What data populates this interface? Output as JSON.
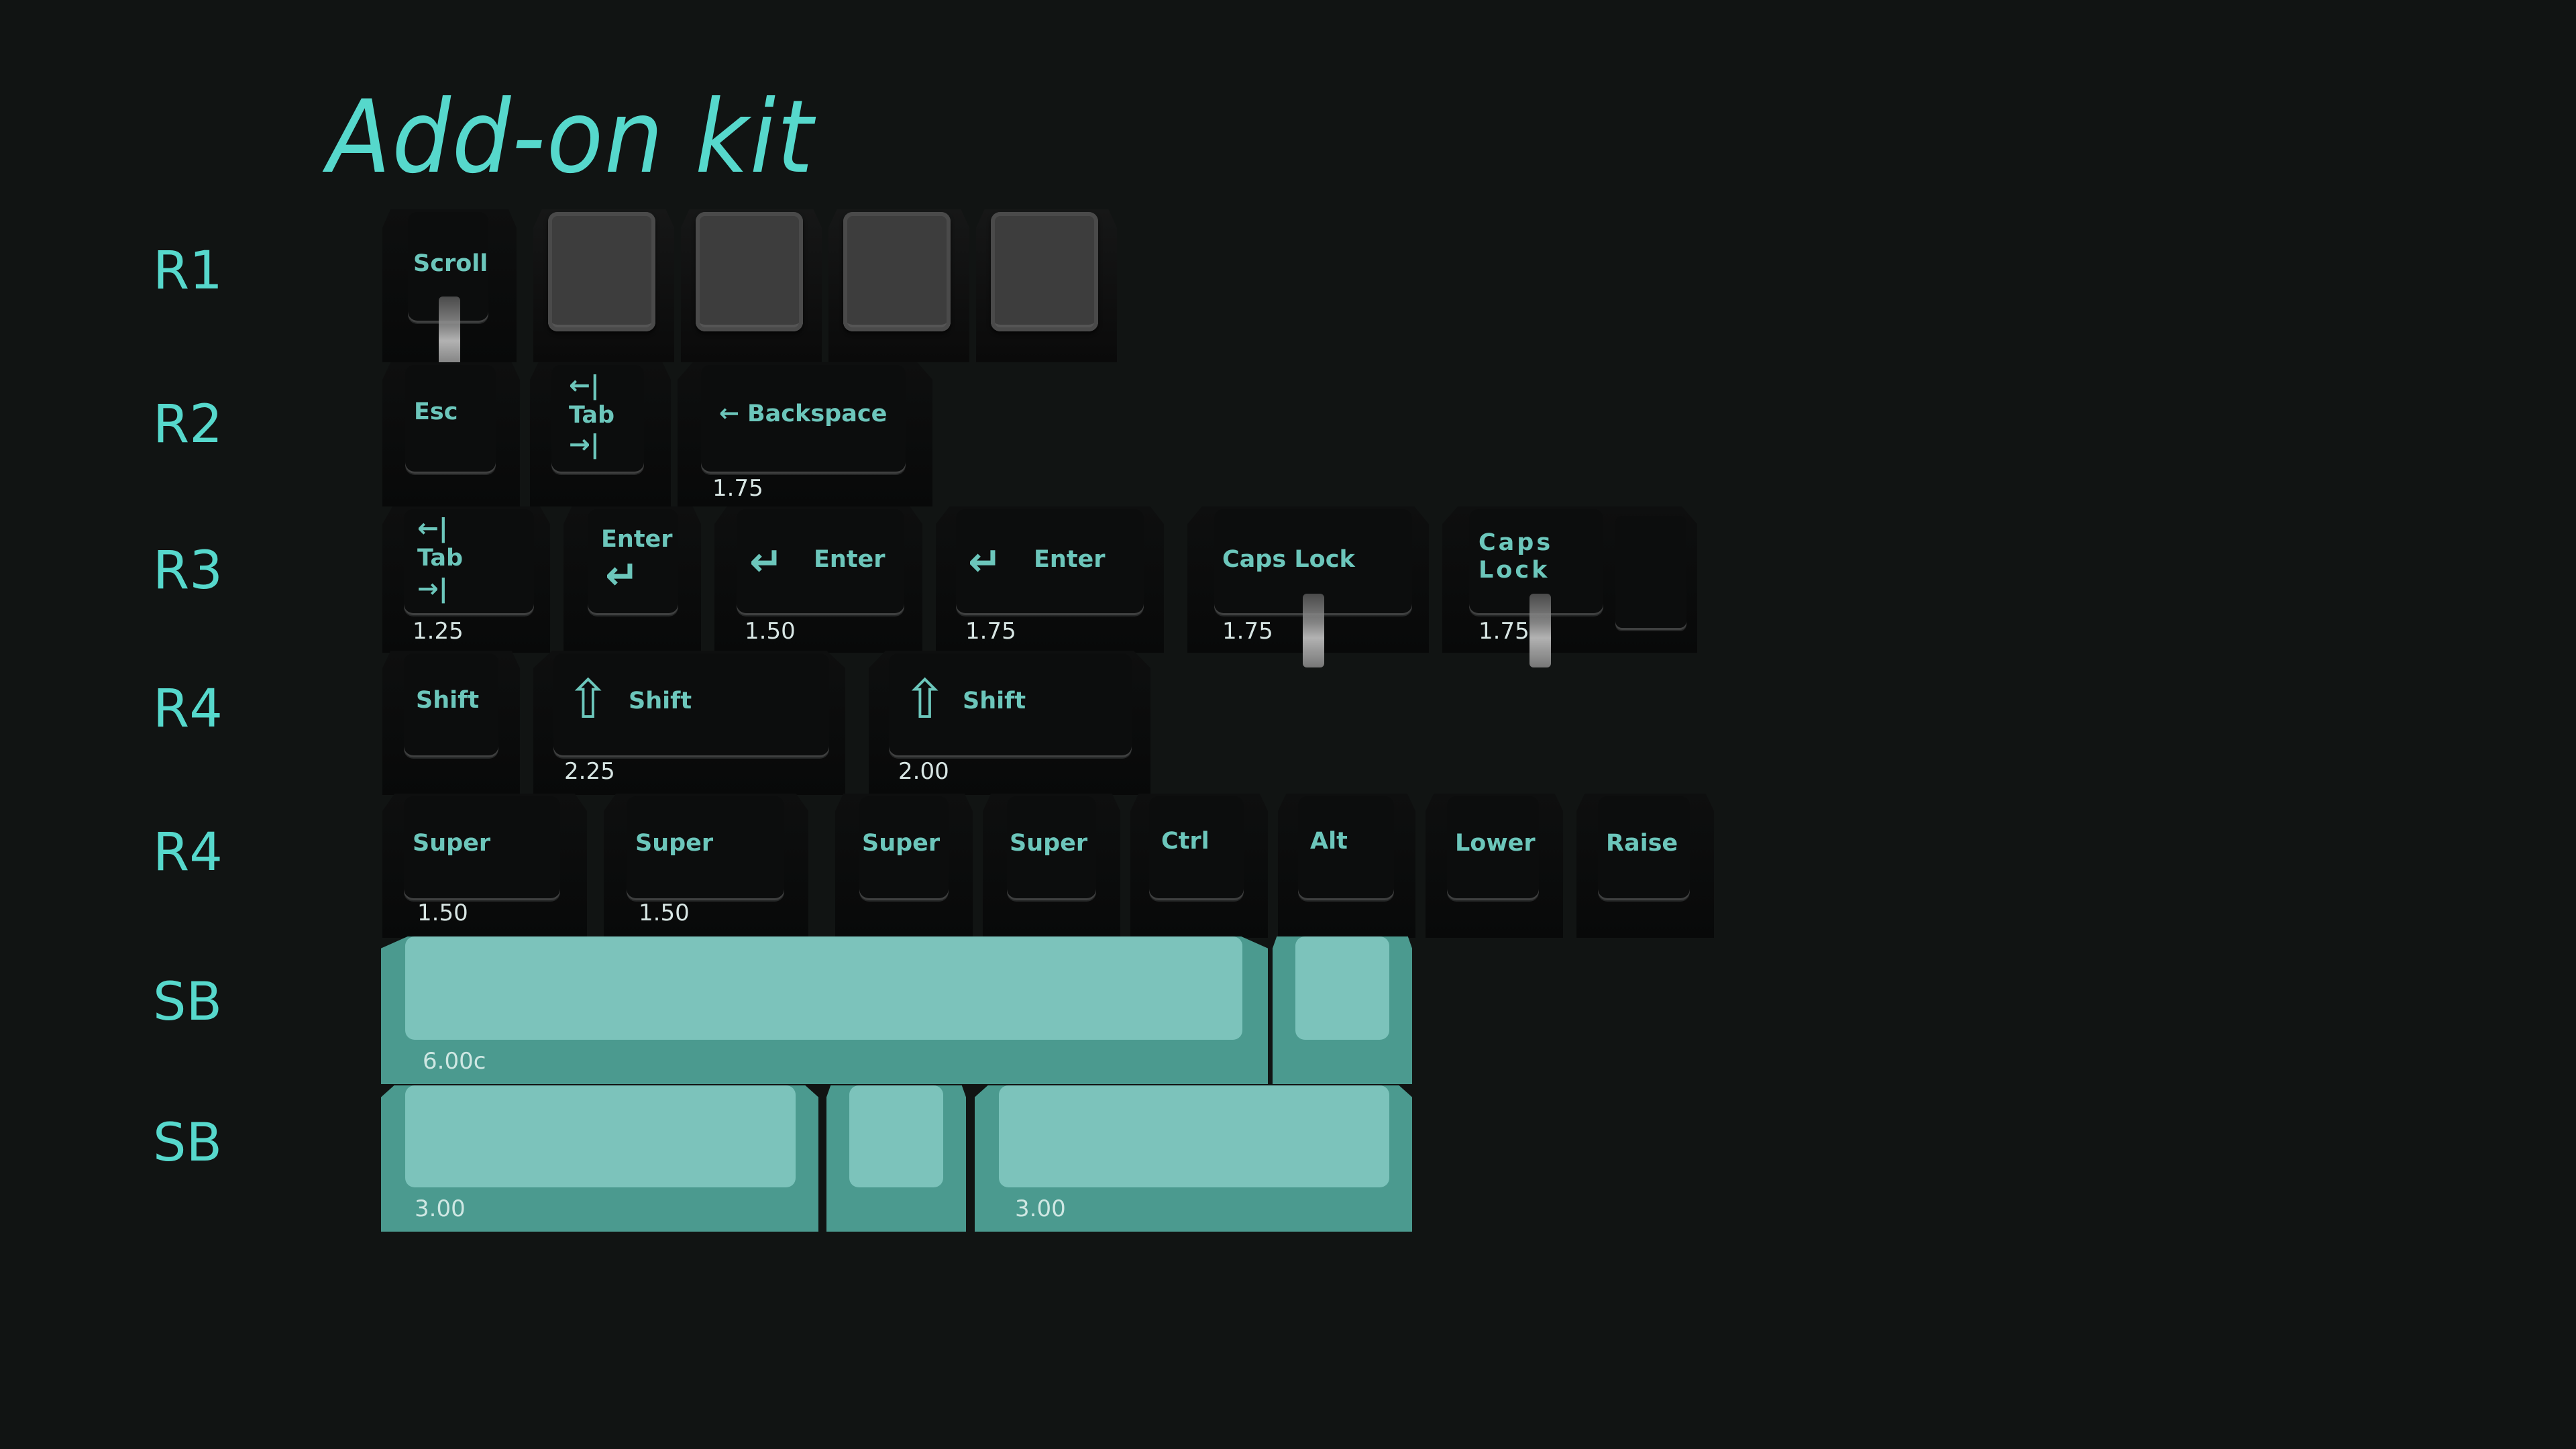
{
  "title": "Add-on kit",
  "colors": {
    "accent": "#56d8cc",
    "legend": "#6cc6bb",
    "background": "#111413",
    "spacebar": "#7cc3bb",
    "keycap_dark": "#0c0d0d",
    "keycap_gray": "#3d3d3d"
  },
  "rows": [
    {
      "label": "R1"
    },
    {
      "label": "R2"
    },
    {
      "label": "R3"
    },
    {
      "label": "R4"
    },
    {
      "label": "R4"
    },
    {
      "label": "SB"
    },
    {
      "label": "SB"
    }
  ],
  "r1": {
    "keys": [
      {
        "legend": "Scroll",
        "style": "dark",
        "has_stem": true
      },
      {
        "legend": "",
        "style": "gray"
      },
      {
        "legend": "",
        "style": "gray"
      },
      {
        "legend": "",
        "style": "gray"
      },
      {
        "legend": "",
        "style": "gray"
      }
    ]
  },
  "r2": {
    "keys": [
      {
        "legend": "Esc"
      },
      {
        "legend": "Tab",
        "icon_top": "←|",
        "icon_bottom": "→|"
      },
      {
        "legend": "Backspace",
        "icon": "←",
        "size": "1.75"
      }
    ]
  },
  "r3": {
    "keys": [
      {
        "legend": "Tab",
        "icon_top": "←|",
        "icon_bottom": "→|",
        "size": "1.25"
      },
      {
        "legend": "Enter",
        "icon": "↵"
      },
      {
        "legend": "Enter",
        "icon": "↵",
        "size": "1.50"
      },
      {
        "legend": "Enter",
        "icon": "↵",
        "size": "1.75"
      },
      {
        "legend": "Caps Lock",
        "size": "1.75",
        "has_stem": true
      },
      {
        "legend": "Caps\nLock",
        "line1": "Caps",
        "line2": "Lock",
        "size": "1.75",
        "has_stem": true,
        "stepped": true
      }
    ]
  },
  "r4a": {
    "keys": [
      {
        "legend": "Shift"
      },
      {
        "legend": "Shift",
        "icon": "⇧",
        "size": "2.25"
      },
      {
        "legend": "Shift",
        "icon": "⇧",
        "size": "2.00"
      }
    ]
  },
  "r4b": {
    "keys": [
      {
        "legend": "Super",
        "size": "1.50"
      },
      {
        "legend": "Super",
        "size": "1.50"
      },
      {
        "legend": "Super"
      },
      {
        "legend": "Super"
      },
      {
        "legend": "Ctrl"
      },
      {
        "legend": "Alt"
      },
      {
        "legend": "Lower"
      },
      {
        "legend": "Raise"
      }
    ]
  },
  "sb1": {
    "keys": [
      {
        "size": "6.00c"
      },
      {
        "size": ""
      }
    ]
  },
  "sb2": {
    "keys": [
      {
        "size": "3.00"
      },
      {
        "size": ""
      },
      {
        "size": "3.00"
      }
    ]
  }
}
